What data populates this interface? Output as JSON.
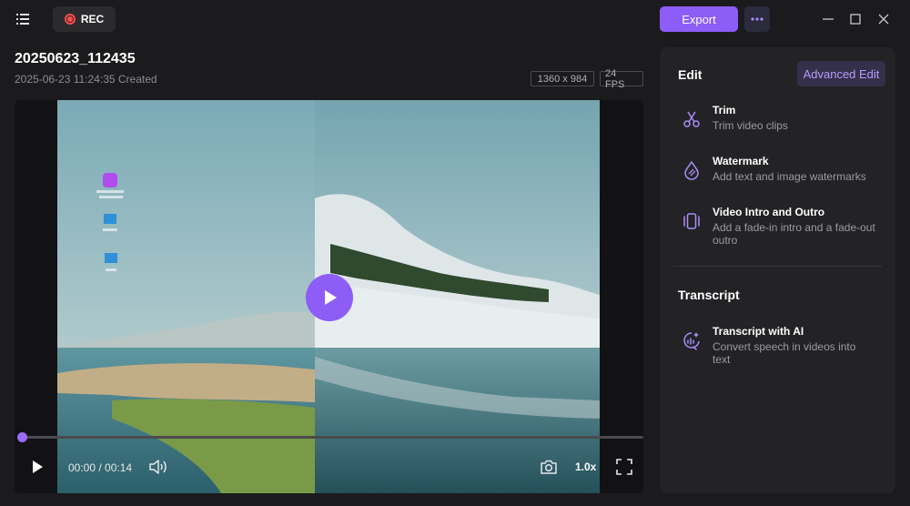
{
  "toolbar": {
    "rec_label": "REC",
    "export_label": "Export"
  },
  "recording": {
    "title": "20250623_112435",
    "created": "2025-06-23 11:24:35 Created",
    "resolution": "1360 x 984",
    "fps": "24 FPS"
  },
  "player": {
    "time": "00:00 / 00:14",
    "speed": "1.0x",
    "progress": 0.0
  },
  "panel": {
    "edit_title": "Edit",
    "advanced_edit_label": "Advanced Edit",
    "features": [
      {
        "icon": "scissors-icon",
        "title": "Trim",
        "desc": "Trim video clips"
      },
      {
        "icon": "watermark-icon",
        "title": "Watermark",
        "desc": "Add text and image watermarks"
      },
      {
        "icon": "intro-outro-icon",
        "title": "Video Intro and Outro",
        "desc": "Add a fade-in intro and a fade-out outro"
      }
    ],
    "transcript_title": "Transcript",
    "transcript_feature": {
      "icon": "ai-transcript-icon",
      "title": "Transcript with AI",
      "desc": "Convert speech in videos into text"
    }
  },
  "colors": {
    "accent": "#8e5cf6",
    "background": "#1b1b1d",
    "panel": "#232326",
    "rec": "#ff4b4b"
  }
}
